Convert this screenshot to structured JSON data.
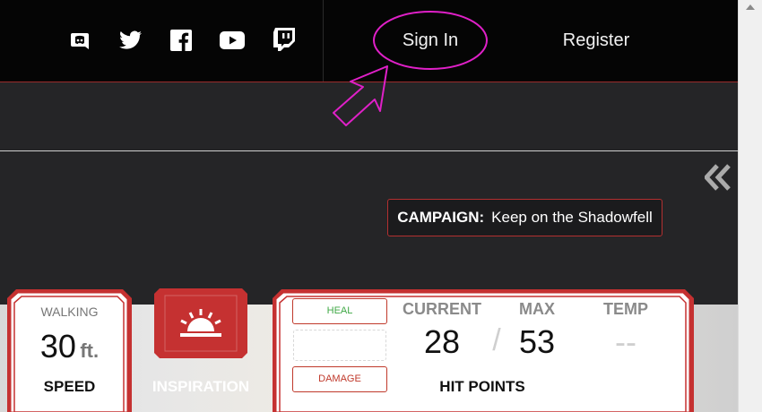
{
  "nav": {
    "social": [
      "discord-icon",
      "twitter-icon",
      "facebook-icon",
      "youtube-icon",
      "twitch-icon"
    ],
    "signin_label": "Sign In",
    "register_label": "Register"
  },
  "campaign": {
    "label": "CAMPAIGN:",
    "name": "Keep on the Shadowfell"
  },
  "speed": {
    "label": "WALKING",
    "value": "30",
    "unit": "ft.",
    "title": "SPEED"
  },
  "inspiration": {
    "title": "INSPIRATION"
  },
  "hit_points": {
    "heal_label": "HEAL",
    "damage_label": "DAMAGE",
    "current_label": "CURRENT",
    "max_label": "MAX",
    "temp_label": "TEMP",
    "current": "28",
    "separator": "/",
    "max": "53",
    "temp": "--",
    "title": "HIT POINTS"
  },
  "colors": {
    "accent": "#c53131",
    "annotation": "#e020c8",
    "heal": "#3fa845",
    "damage": "#c0392b"
  }
}
